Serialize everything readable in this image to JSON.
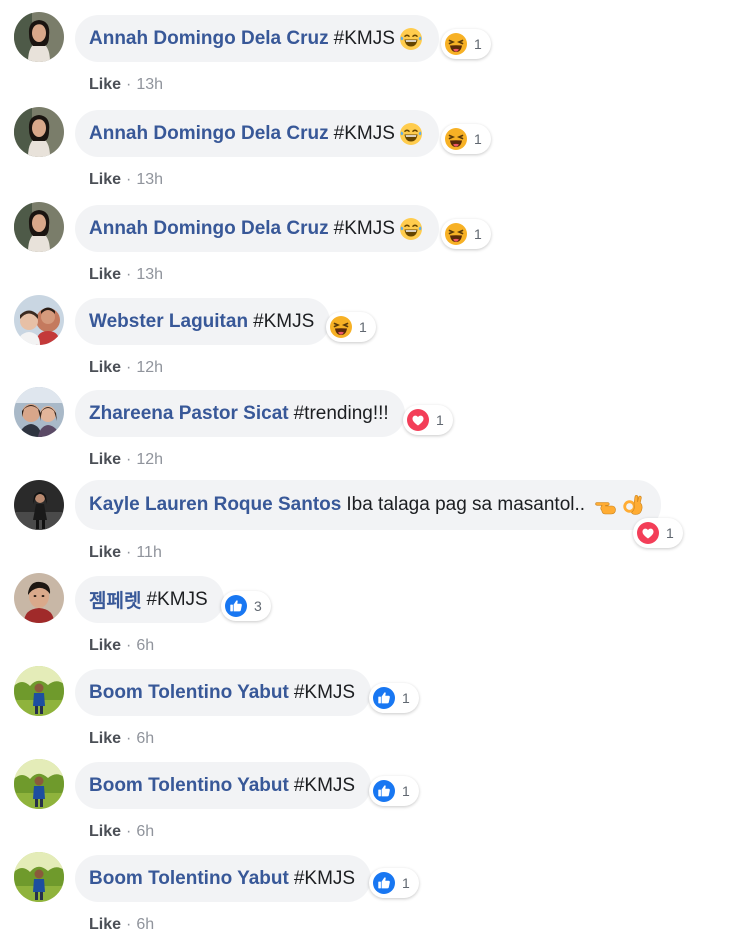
{
  "like_label": "Like",
  "colors": {
    "name": "#385898",
    "bubble": "#f2f3f5",
    "love": "#f33e58",
    "like": "#1877f2",
    "haha": "#f7b125"
  },
  "comments": [
    {
      "author": "Annah Domingo Dela Cruz",
      "text": "#KMJS",
      "emoji_icons": [
        "laughing-tears-emoji"
      ],
      "reaction_icon": "haha-icon",
      "reaction_count": "1",
      "time": "13h"
    },
    {
      "author": "Annah Domingo Dela Cruz",
      "text": "#KMJS",
      "emoji_icons": [
        "laughing-tears-emoji"
      ],
      "reaction_icon": "haha-icon",
      "reaction_count": "1",
      "time": "13h"
    },
    {
      "author": "Annah Domingo Dela Cruz",
      "text": "#KMJS",
      "emoji_icons": [
        "laughing-tears-emoji"
      ],
      "reaction_icon": "haha-icon",
      "reaction_count": "1",
      "time": "13h"
    },
    {
      "author": "Webster Laguitan",
      "text": "#KMJS",
      "emoji_icons": [],
      "reaction_icon": "haha-icon",
      "reaction_count": "1",
      "time": "12h"
    },
    {
      "author": "Zhareena Pastor Sicat",
      "text": "#trending!!!",
      "emoji_icons": [],
      "reaction_icon": "love-icon",
      "reaction_count": "1",
      "time": "12h"
    },
    {
      "author": "Kayle Lauren Roque Santos",
      "text": "Iba talaga pag sa masantol..",
      "emoji_icons": [
        "pointing-hand-emoji",
        "ok-hand-emoji"
      ],
      "reaction_icon": "love-icon",
      "reaction_count": "1",
      "time": "11h"
    },
    {
      "author": "젬페렛",
      "text": "#KMJS",
      "emoji_icons": [],
      "reaction_icon": "like-icon",
      "reaction_count": "3",
      "time": "6h"
    },
    {
      "author": "Boom Tolentino Yabut",
      "text": "#KMJS",
      "emoji_icons": [],
      "reaction_icon": "like-icon",
      "reaction_count": "1",
      "time": "6h"
    },
    {
      "author": "Boom Tolentino Yabut",
      "text": "#KMJS",
      "emoji_icons": [],
      "reaction_icon": "like-icon",
      "reaction_count": "1",
      "time": "6h"
    },
    {
      "author": "Boom Tolentino Yabut",
      "text": "#KMJS",
      "emoji_icons": [],
      "reaction_icon": "like-icon",
      "reaction_count": "1",
      "time": "6h"
    }
  ]
}
